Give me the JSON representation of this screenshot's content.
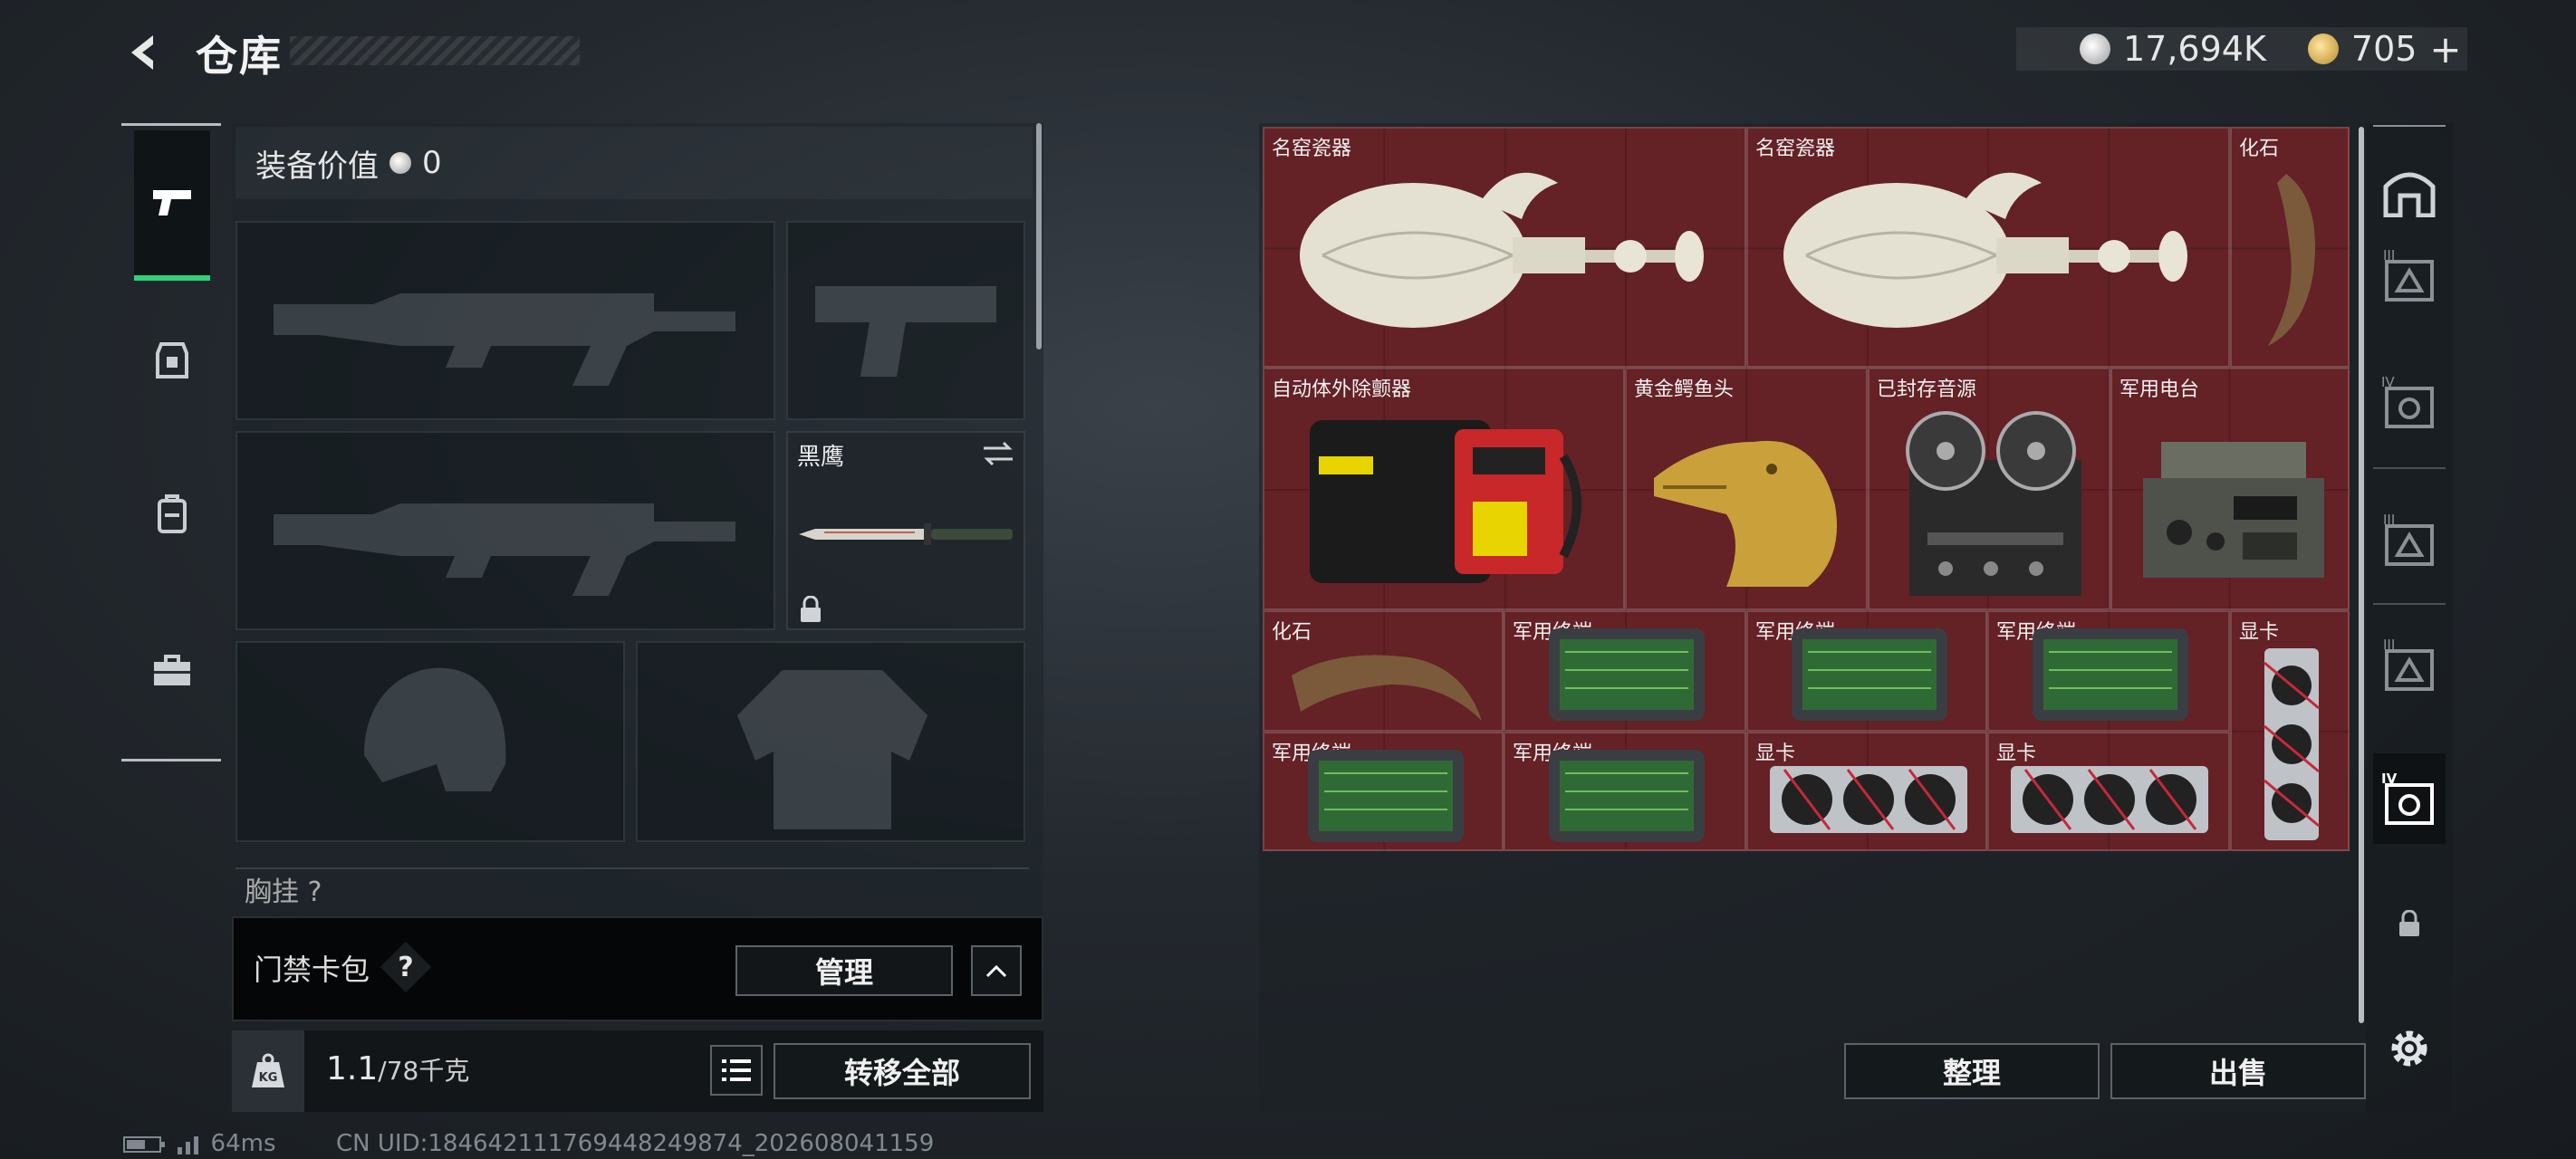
{
  "header": {
    "title": "仓库",
    "silver_amount": "17,694K",
    "gold_amount": "705",
    "add_label": "+"
  },
  "equipment": {
    "value_label": "装备价值",
    "value": "0",
    "knife_name": "黑鹰",
    "chest_label": "胸挂",
    "chest_suffix": "?"
  },
  "card_pack": {
    "label": "门禁卡包",
    "help": "?",
    "manage_label": "管理"
  },
  "weight": {
    "current": "1.1",
    "capacity": "/78千克",
    "icon_text": "KG"
  },
  "transfer_all_label": "转移全部",
  "status": {
    "ping": "64ms",
    "uid": "CN UID:184642111769448249874_202608041159"
  },
  "storage": {
    "items": [
      {
        "name": "名窑瓷器"
      },
      {
        "name": "名窑瓷器"
      },
      {
        "name": "化石"
      },
      {
        "name": "自动体外除颤器"
      },
      {
        "name": "黄金鳄鱼头"
      },
      {
        "name": "已封存音源"
      },
      {
        "name": "军用电台"
      },
      {
        "name": "化石"
      },
      {
        "name": "军用终端"
      },
      {
        "name": "军用终端"
      },
      {
        "name": "军用终端"
      },
      {
        "name": "显卡"
      },
      {
        "name": "军用终端"
      },
      {
        "name": "军用终端"
      },
      {
        "name": "显卡"
      },
      {
        "name": "显卡"
      }
    ],
    "sort_label": "整理",
    "sell_label": "出售"
  },
  "right_rail": {
    "tier_labels": [
      "III",
      "IV",
      "III",
      "III",
      "IV"
    ]
  },
  "colors": {
    "accent_green": "#2fd07a",
    "grid_red": "#5a1e22"
  }
}
